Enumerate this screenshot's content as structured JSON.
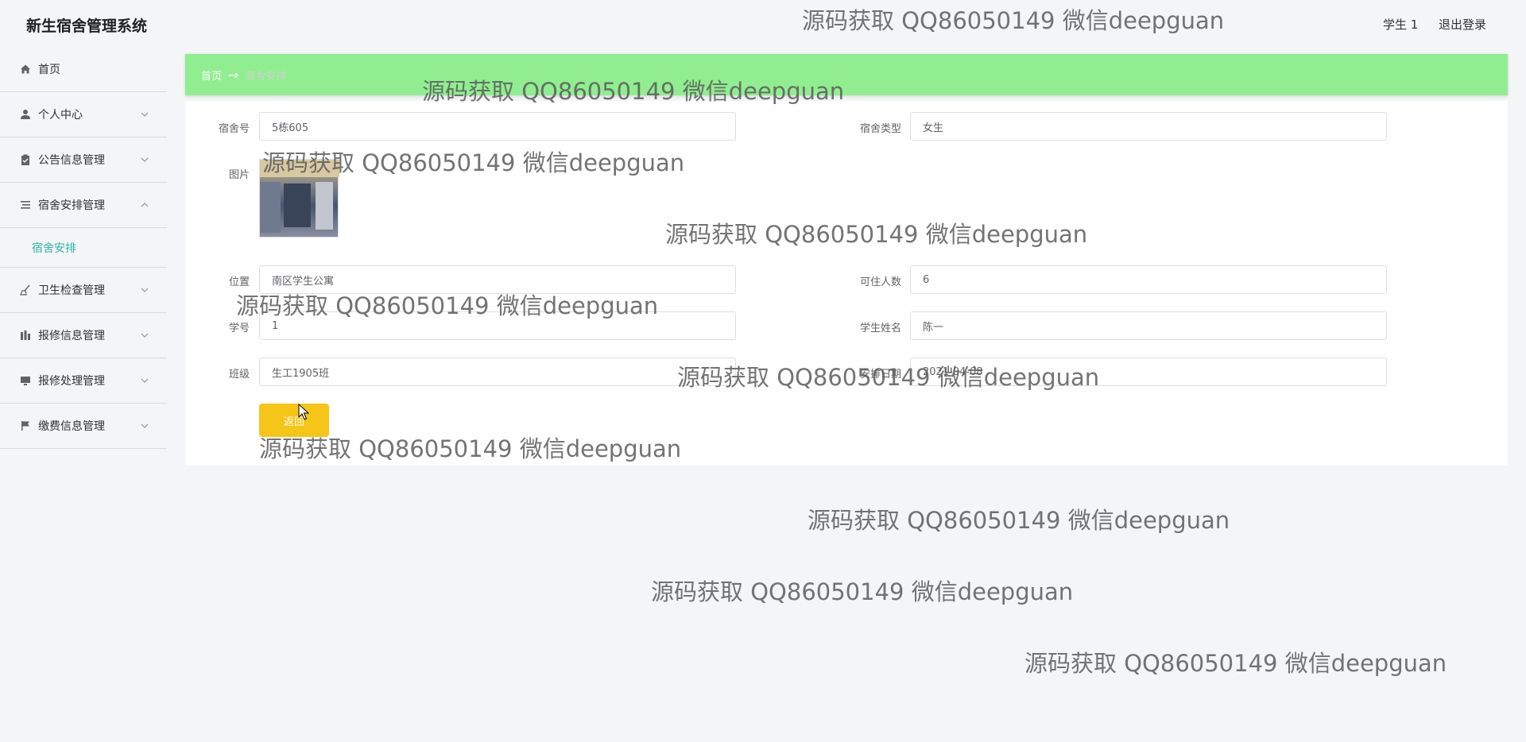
{
  "header": {
    "app_title": "新生宿舍管理系统",
    "user": "学生 1",
    "logout": "退出登录"
  },
  "sidebar": {
    "items": [
      {
        "label": "首页",
        "icon": "home-icon"
      },
      {
        "label": "个人中心",
        "icon": "user-icon"
      },
      {
        "label": "公告信息管理",
        "icon": "clipboard-icon"
      },
      {
        "label": "宿舍安排管理",
        "icon": "list-icon"
      },
      {
        "label": "卫生检查管理",
        "icon": "broom-icon"
      },
      {
        "label": "报修信息管理",
        "icon": "bar-icon"
      },
      {
        "label": "报修处理管理",
        "icon": "monitor-icon"
      },
      {
        "label": "缴费信息管理",
        "icon": "flag-icon"
      }
    ],
    "active_sub": "宿舍安排"
  },
  "breadcrumb": {
    "home": "首页",
    "arrow": "→",
    "current": "宿舍安排"
  },
  "form": {
    "dorm_no_label": "宿舍号",
    "dorm_no": "5栋605",
    "dorm_type_label": "宿舍类型",
    "dorm_type": "女生",
    "image_label": "图片",
    "location_label": "位置",
    "location": "南区学生公寓",
    "capacity_label": "可住人数",
    "capacity": "6",
    "student_no_label": "学号",
    "student_no": "1",
    "student_name_label": "学生姓名",
    "student_name": "陈一",
    "class_label": "班级",
    "class": "生工1905班",
    "date_label": "安排日期",
    "date": "2021-04-08",
    "back_button": "返回"
  },
  "watermark": "源码获取 QQ86050149 微信deepguan"
}
